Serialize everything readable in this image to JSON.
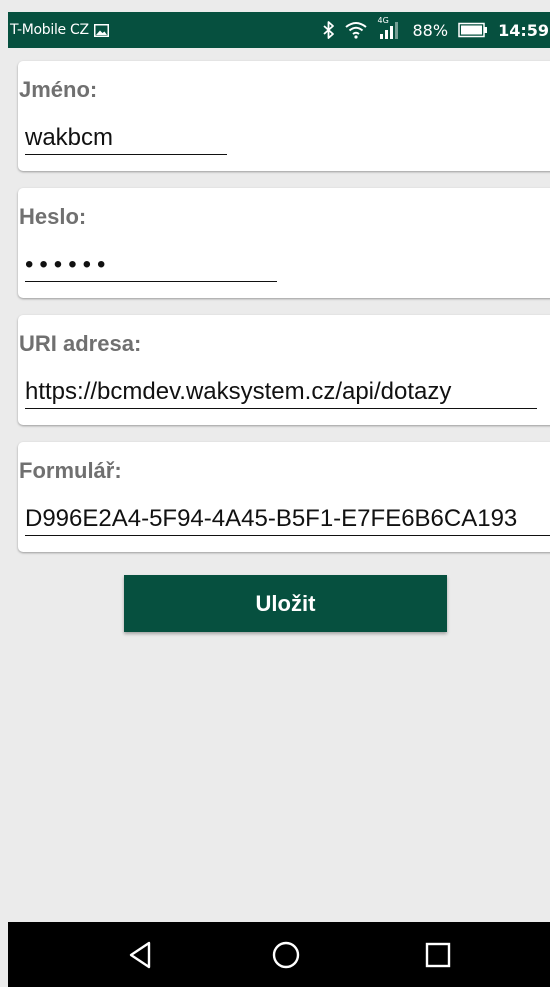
{
  "status_bar": {
    "carrier": "T-Mobile CZ",
    "network_type": "4G",
    "battery_percent": "88%",
    "time": "14:59",
    "icons": [
      "image-icon",
      "bluetooth-icon",
      "wifi-icon",
      "signal-icon",
      "battery-icon"
    ]
  },
  "form": {
    "username": {
      "label": "Jméno:",
      "value": "wakbcm"
    },
    "password": {
      "label": "Heslo:",
      "masked_value": "••••••"
    },
    "uri": {
      "label": "URI adresa:",
      "value": "https://bcmdev.waksystem.cz/api/dotazy"
    },
    "form_id": {
      "label": "Formulář:",
      "value": "D996E2A4-5F94-4A45-B5F1-E7FE6B6CA193"
    }
  },
  "save_button": {
    "label": "Uložit"
  },
  "navigation": {
    "icons": [
      "back-icon",
      "home-icon",
      "recents-icon"
    ]
  },
  "colors": {
    "primary": "#06503f",
    "background": "#ebebeb",
    "label": "#707070",
    "nav_bar": "#000000"
  }
}
